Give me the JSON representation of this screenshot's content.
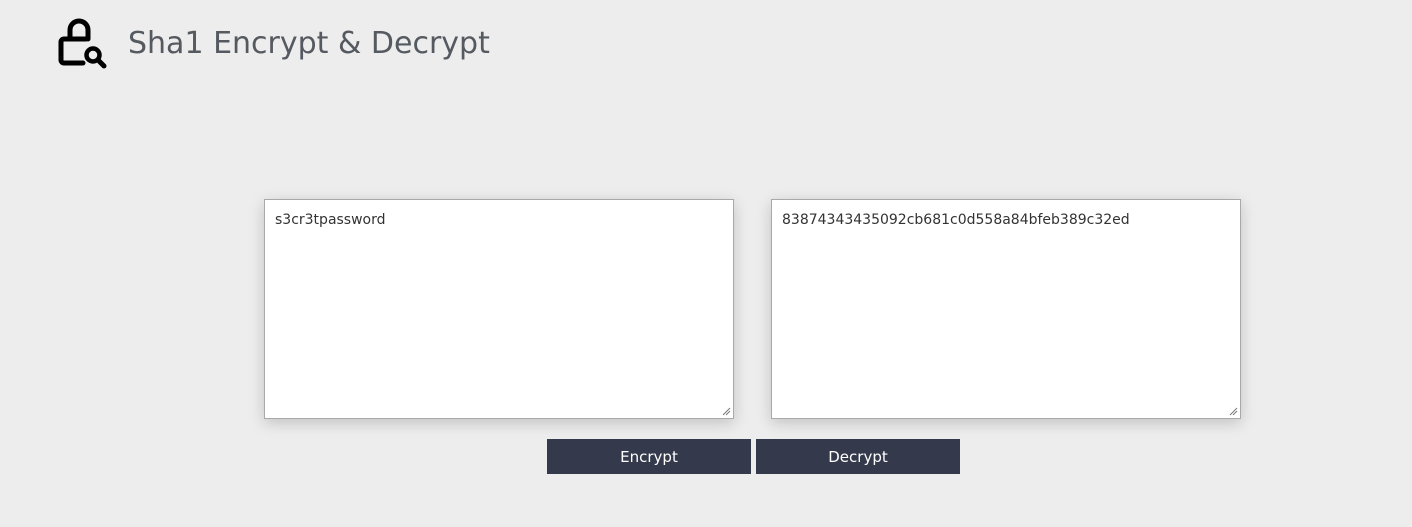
{
  "header": {
    "logo_icon": "lock-search-icon",
    "title": "Sha1 Encrypt & Decrypt"
  },
  "input_panel": {
    "value": "s3cr3tpassword"
  },
  "output_panel": {
    "value": "83874343435092cb681c0d558a84bfeb389c32ed"
  },
  "actions": {
    "encrypt_label": "Encrypt",
    "decrypt_label": "Decrypt"
  },
  "colors": {
    "background": "#ededed",
    "button": "#343a4b",
    "title": "#555a60"
  }
}
